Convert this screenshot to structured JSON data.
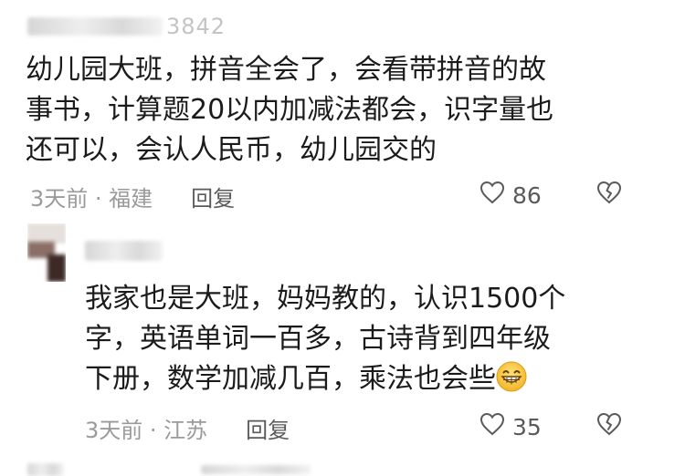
{
  "comments": [
    {
      "username_visible": "3842",
      "body_lines": [
        "幼儿园大班，拼音全会了，会看带拼音的故",
        "事书，计算题20以内加减法都会，识字量也",
        "还可以，会认人民币，幼儿园交的"
      ],
      "time_location": "3天前 · 福建",
      "reply_label": "回复",
      "likes": "86"
    },
    {
      "username_visible": "",
      "body_lines": [
        "我家也是大班，妈妈教的，认识1500个",
        "字，英语单词一百多，古诗背到四年级",
        "下册，数学加减几百，乘法也会些"
      ],
      "emoji": "grin-emoji",
      "time_location": "3天前 · 江苏",
      "reply_label": "回复",
      "likes": "35"
    }
  ],
  "icons": {
    "like": "heart-outline-icon",
    "dislike": "broken-heart-icon"
  },
  "colors": {
    "text": "#1b1b1b",
    "meta": "#9a9a9a",
    "action": "#5a5a5a"
  }
}
